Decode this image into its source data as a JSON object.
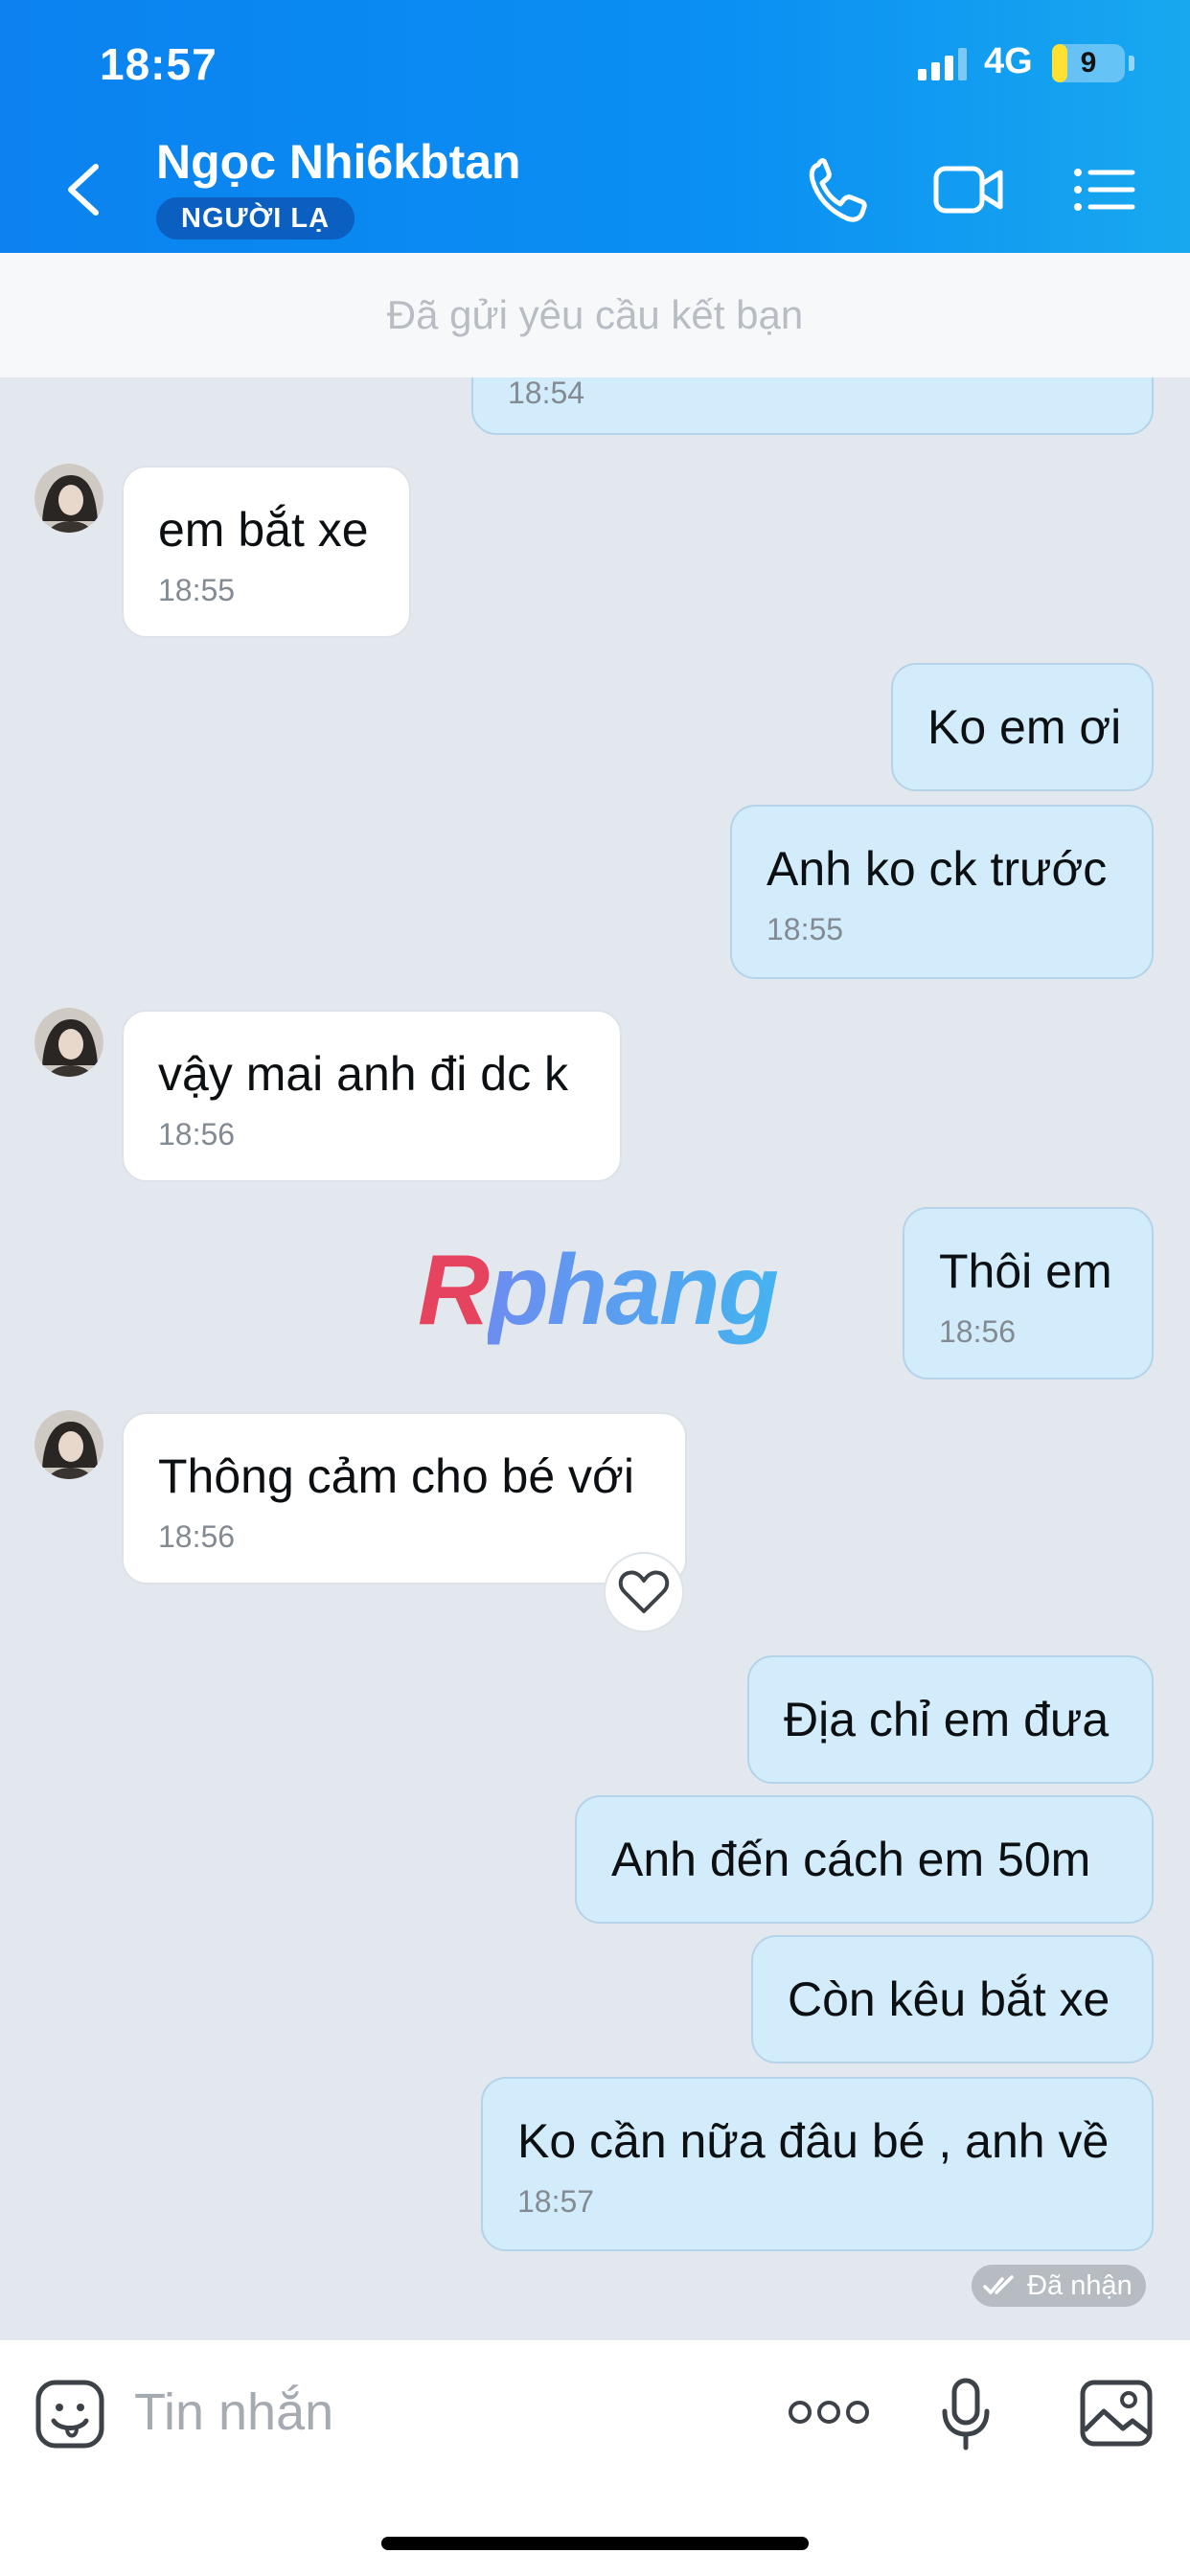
{
  "status_bar": {
    "time": "18:57",
    "network": "4G",
    "battery": "9"
  },
  "header": {
    "contact_name": "Ngọc Nhi6kbtan",
    "badge": "NGƯỜI LẠ"
  },
  "friend_request": {
    "text": "Đã gửi yêu cầu kết bạn"
  },
  "messages": [
    {
      "side": "out",
      "text": "",
      "time": "18:54"
    },
    {
      "side": "in",
      "text": "em bắt xe",
      "time": "18:55"
    },
    {
      "side": "out",
      "text": "Ko em ơi",
      "time": ""
    },
    {
      "side": "out",
      "text": "Anh ko ck trước",
      "time": "18:55"
    },
    {
      "side": "in",
      "text": "vậy mai anh đi dc k",
      "time": "18:56"
    },
    {
      "side": "out",
      "text": "Thôi em",
      "time": "18:56"
    },
    {
      "side": "in",
      "text": "Thông cảm cho bé với",
      "time": "18:56"
    },
    {
      "side": "out",
      "text": "Địa chỉ em đưa",
      "time": ""
    },
    {
      "side": "out",
      "text": "Anh đến cách em 50m",
      "time": ""
    },
    {
      "side": "out",
      "text": "Còn kêu bắt xe",
      "time": ""
    },
    {
      "side": "out",
      "text": "Ko cần nữa đâu bé , anh về",
      "time": "18:57"
    }
  ],
  "watermark": {
    "first": "R",
    "rest": "phang"
  },
  "delivery_status": "Đã nhận",
  "input": {
    "placeholder": "Tin nhắn"
  },
  "colors": {
    "header_blue": "#0b82f0",
    "outgoing_bubble": "#d2ecfb",
    "incoming_bubble": "#ffffff",
    "chat_bg": "#e3e8ef"
  },
  "icons": [
    "back-arrow-icon",
    "phone-icon",
    "video-call-icon",
    "menu-list-icon",
    "sticker-icon",
    "more-icon",
    "microphone-icon",
    "image-icon",
    "heart-icon"
  ]
}
